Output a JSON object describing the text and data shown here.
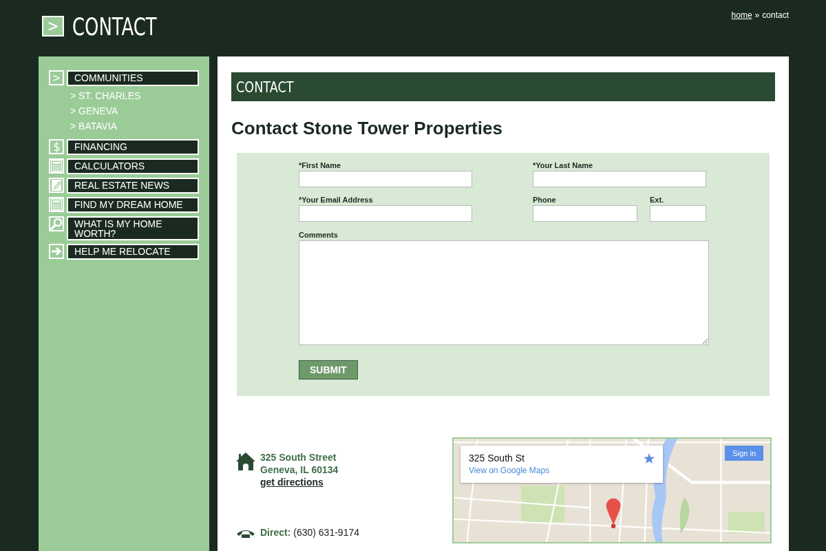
{
  "header": {
    "glyph": ">",
    "title": "CONTACT",
    "breadcrumb": {
      "link": "home",
      "separator": "»",
      "current": "contact"
    }
  },
  "sidebar": {
    "items": [
      {
        "label": "COMMUNITIES",
        "kind": "glyph",
        "glyph": ">",
        "children": [
          {
            "label": "> ST. CHARLES"
          },
          {
            "label": "> GENEVA"
          },
          {
            "label": "> BATAVIA"
          }
        ]
      },
      {
        "label": "FINANCING",
        "kind": "glyph",
        "glyph": "$"
      },
      {
        "label": "CALCULATORS",
        "kind": "calculator"
      },
      {
        "label": "REAL ESTATE NEWS",
        "kind": "note"
      },
      {
        "label": "FIND MY DREAM HOME",
        "kind": "calculator"
      },
      {
        "label": "WHAT IS MY HOME WORTH?",
        "kind": "magnifier"
      },
      {
        "label": "HELP ME RELOCATE",
        "kind": "arrow"
      }
    ]
  },
  "section_title": "CONTACT",
  "heading": "Contact Stone Tower Properties",
  "form": {
    "rows": [
      [
        {
          "label": "*First Name"
        },
        {
          "label": "*Your Last Name"
        }
      ],
      [
        {
          "label": "*Your Email Address"
        },
        {
          "label": "Phone"
        },
        {
          "label": "Ext."
        }
      ]
    ],
    "comments_label": "Comments",
    "submit": "SUBMIT"
  },
  "contact": {
    "address_lines": [
      "325 South Street",
      "Geneva, IL 60134"
    ],
    "directions": "get directions",
    "phone": "**Direct:** (630) 631-9174"
  },
  "map": {
    "card_title": "325 South St",
    "card_link": "View on Google Maps",
    "sign_in": "Sign in"
  }
}
